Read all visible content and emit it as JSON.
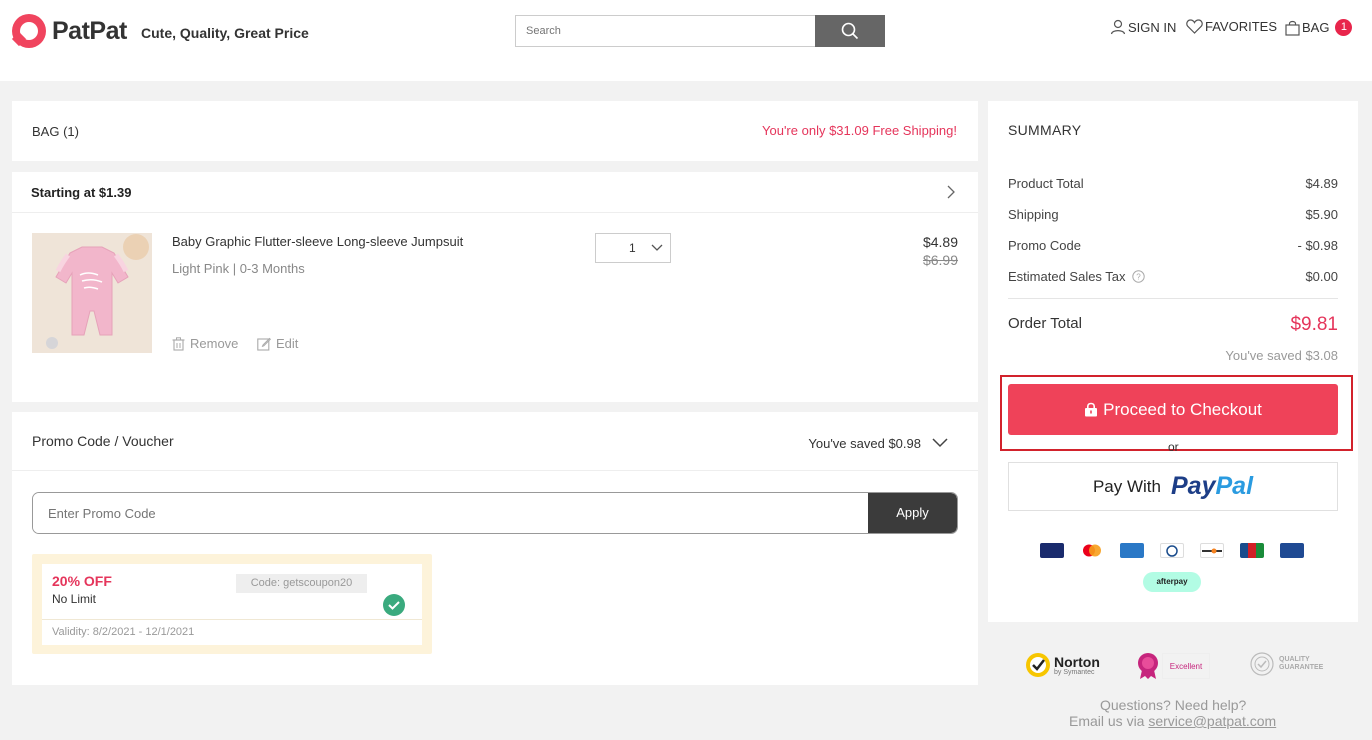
{
  "header": {
    "logo_text": "PatPat",
    "tagline": "Cute, Quality, Great Price",
    "search_placeholder": "Search",
    "signin_label": "SIGN IN",
    "favorites_label": "FAVORITES",
    "bag_label": "BAG",
    "bag_count": "1"
  },
  "bag": {
    "title": "BAG (1)",
    "free_shipping_msg": "You're only $31.09 Free Shipping!",
    "starting_at": "Starting at $1.39",
    "item": {
      "name": "Baby Graphic Flutter-sleeve Long-sleeve Jumpsuit",
      "variant": "Light Pink | 0-3 Months",
      "quantity": "1",
      "price": "$4.89",
      "original_price": "$6.99",
      "remove_label": "Remove",
      "edit_label": "Edit"
    }
  },
  "promo": {
    "title": "Promo Code / Voucher",
    "saved": "You've saved $0.98",
    "input_placeholder": "Enter Promo Code",
    "apply_label": "Apply",
    "coupon": {
      "discount": "20% OFF",
      "limit": "No Limit",
      "code": "Code: getscoupon20",
      "validity": "Validity: 8/2/2021 - 12/1/2021"
    }
  },
  "summary": {
    "title": "SUMMARY",
    "rows": [
      {
        "label": "Product Total",
        "value": "$4.89"
      },
      {
        "label": "Shipping",
        "value": "$5.90"
      },
      {
        "label": "Promo Code",
        "value": "- $0.98"
      },
      {
        "label": "Estimated Sales Tax",
        "value": "$0.00"
      }
    ],
    "order_total_label": "Order Total",
    "order_total_value": "$9.81",
    "saved": "You've saved $3.08",
    "checkout_label": "Proceed to Checkout",
    "or_label": "or",
    "paypal_prefix": "Pay With",
    "paypal_brand_1": "Pay",
    "paypal_brand_2": "Pal",
    "afterpay_label": "afterpay"
  },
  "footer": {
    "norton_label": "Norton",
    "norton_sub": "by Symantec",
    "reseller_label": "Excellent",
    "quality_label": "QUALITY GUARANTEE",
    "help_line": "Questions? Need help?",
    "email_prefix": "Email us via ",
    "email": "service@patpat.com"
  },
  "colors": {
    "accent": "#ef4259",
    "price_red": "#e5355b",
    "highlight_border": "#d2222c"
  }
}
